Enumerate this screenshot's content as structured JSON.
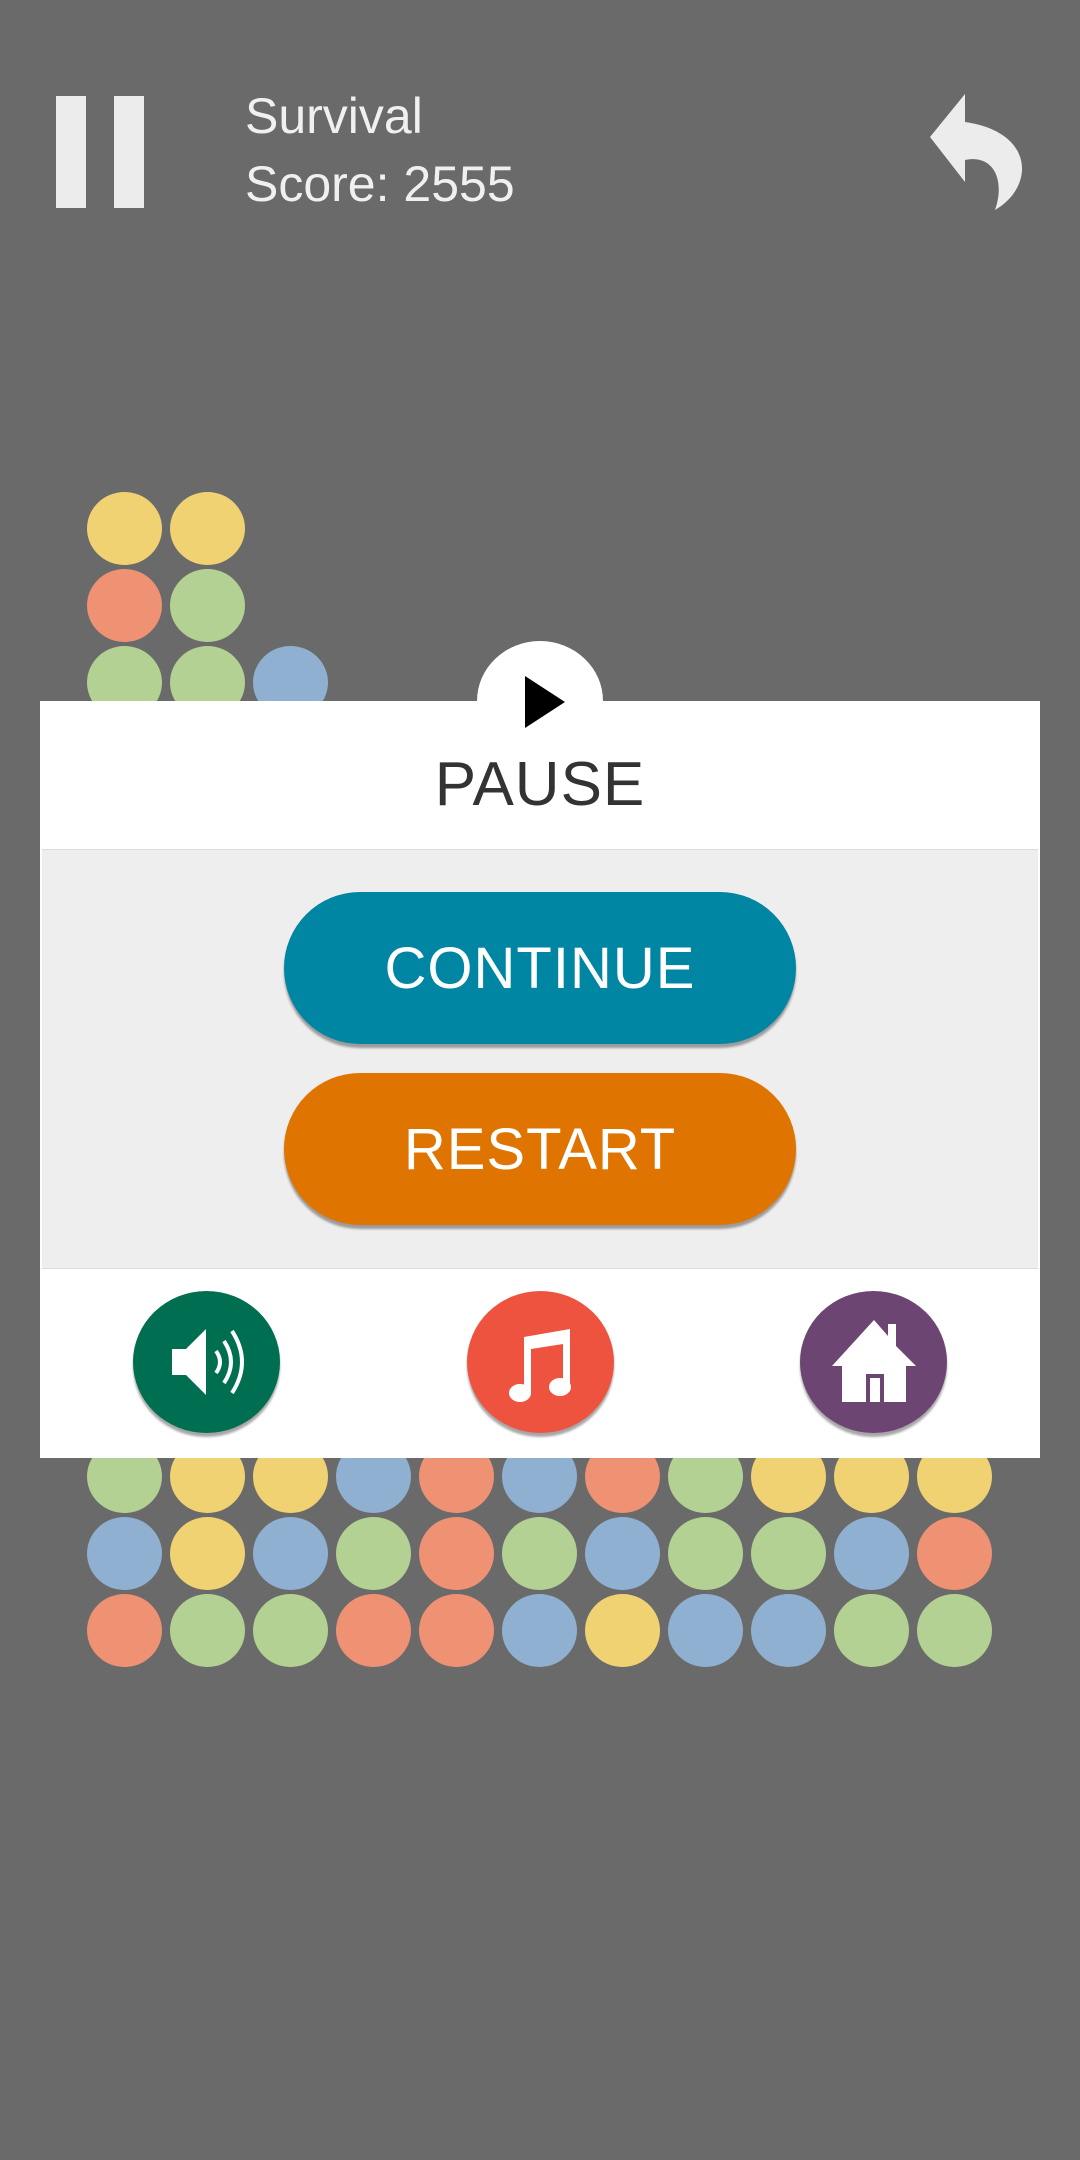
{
  "hud": {
    "mode": "Survival",
    "score_label": "Score: 2555",
    "pause_icon": "pause-icon",
    "undo_icon": "undo-arrow-icon"
  },
  "colors": {
    "background": "#6a6a6a",
    "yellow": "#f0d272",
    "orange": "#ef9173",
    "green": "#b2d193",
    "blue": "#8fb0d0",
    "continue": "#0086a3",
    "restart": "#e07400",
    "sound": "#006e50",
    "music": "#ee5340",
    "home": "#6d4573"
  },
  "board": {
    "top_rows": [
      [
        "yellow",
        "yellow"
      ],
      [
        "orange",
        "green"
      ],
      [
        "green",
        "green",
        "blue"
      ]
    ],
    "bottom_rows": [
      [
        "green",
        "yellow",
        "yellow",
        "blue",
        "orange",
        "blue",
        "orange",
        "green",
        "yellow",
        "yellow",
        "yellow"
      ],
      [
        "blue",
        "yellow",
        "blue",
        "green",
        "orange",
        "green",
        "blue",
        "green",
        "green",
        "blue",
        "orange"
      ],
      [
        "orange",
        "green",
        "green",
        "orange",
        "orange",
        "blue",
        "yellow",
        "blue",
        "blue",
        "green",
        "green"
      ]
    ]
  },
  "dialog": {
    "title": "PAUSE",
    "continue_label": "CONTINUE",
    "restart_label": "RESTART",
    "icons": [
      "play-icon",
      "speaker-icon",
      "music-note-icon",
      "home-icon"
    ]
  }
}
